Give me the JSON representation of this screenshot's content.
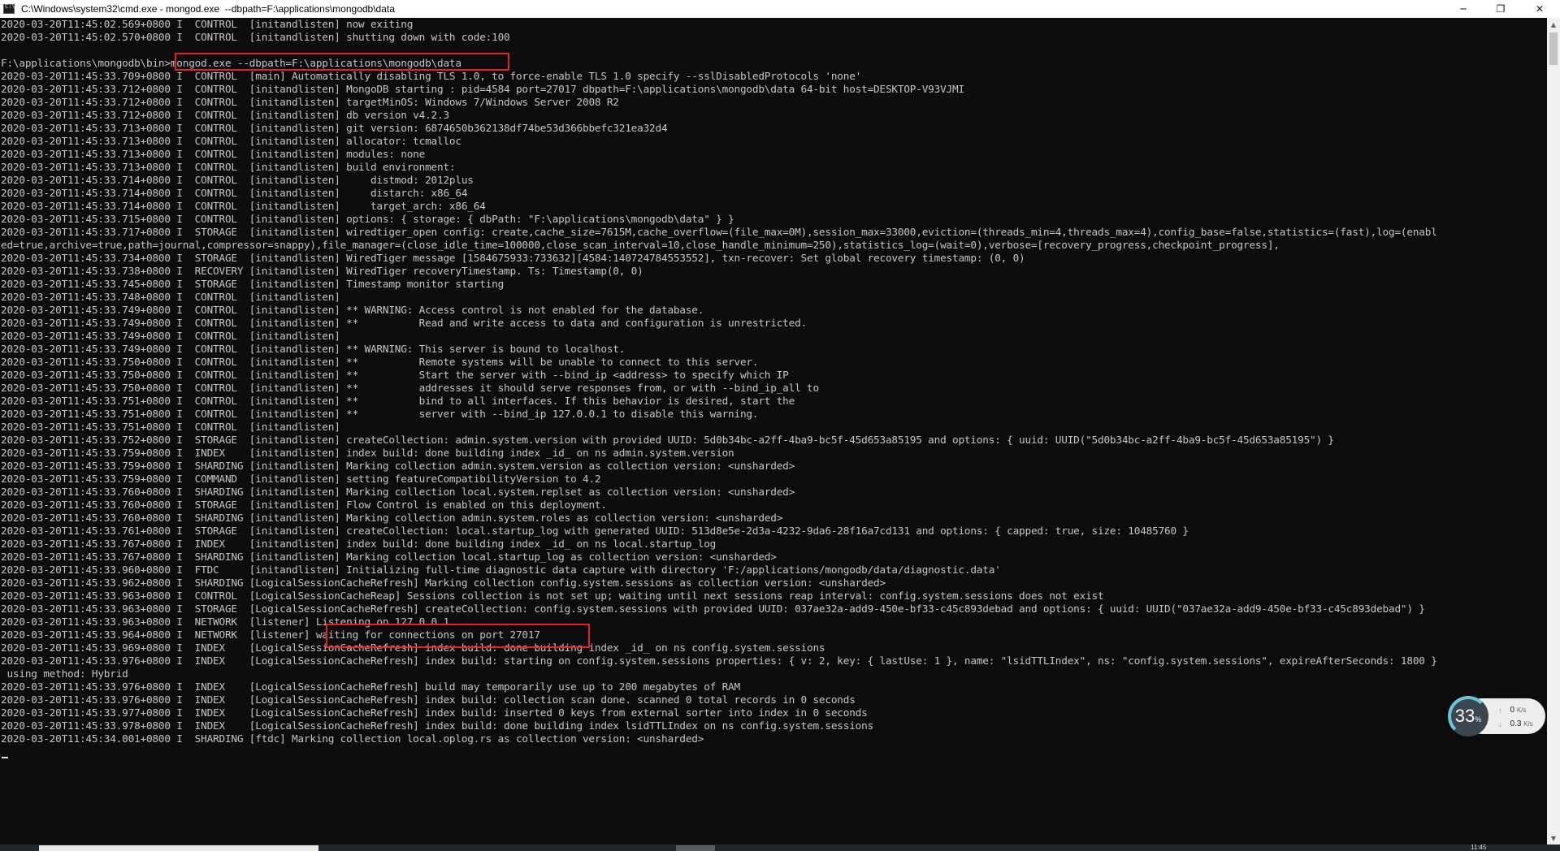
{
  "window": {
    "title": "C:\\Windows\\system32\\cmd.exe - mongod.exe  --dbpath=F:\\applications\\mongodb\\data",
    "minimize": "─",
    "maximize": "❐",
    "close": "✕"
  },
  "console_lines": [
    "2020-03-20T11:45:02.569+0800 I  CONTROL  [initandlisten] now exiting",
    "2020-03-20T11:45:02.570+0800 I  CONTROL  [initandlisten] shutting down with code:100",
    "",
    "F:\\applications\\mongodb\\bin>mongod.exe --dbpath=F:\\applications\\mongodb\\data",
    "2020-03-20T11:45:33.709+0800 I  CONTROL  [main] Automatically disabling TLS 1.0, to force-enable TLS 1.0 specify --sslDisabledProtocols 'none'",
    "2020-03-20T11:45:33.712+0800 I  CONTROL  [initandlisten] MongoDB starting : pid=4584 port=27017 dbpath=F:\\applications\\mongodb\\data 64-bit host=DESKTOP-V93VJMI",
    "2020-03-20T11:45:33.712+0800 I  CONTROL  [initandlisten] targetMinOS: Windows 7/Windows Server 2008 R2",
    "2020-03-20T11:45:33.712+0800 I  CONTROL  [initandlisten] db version v4.2.3",
    "2020-03-20T11:45:33.713+0800 I  CONTROL  [initandlisten] git version: 6874650b362138df74be53d366bbefc321ea32d4",
    "2020-03-20T11:45:33.713+0800 I  CONTROL  [initandlisten] allocator: tcmalloc",
    "2020-03-20T11:45:33.713+0800 I  CONTROL  [initandlisten] modules: none",
    "2020-03-20T11:45:33.713+0800 I  CONTROL  [initandlisten] build environment:",
    "2020-03-20T11:45:33.714+0800 I  CONTROL  [initandlisten]     distmod: 2012plus",
    "2020-03-20T11:45:33.714+0800 I  CONTROL  [initandlisten]     distarch: x86_64",
    "2020-03-20T11:45:33.714+0800 I  CONTROL  [initandlisten]     target_arch: x86_64",
    "2020-03-20T11:45:33.715+0800 I  CONTROL  [initandlisten] options: { storage: { dbPath: \"F:\\applications\\mongodb\\data\" } }",
    "2020-03-20T11:45:33.717+0800 I  STORAGE  [initandlisten] wiredtiger_open config: create,cache_size=7615M,cache_overflow=(file_max=0M),session_max=33000,eviction=(threads_min=4,threads_max=4),config_base=false,statistics=(fast),log=(enabl",
    "ed=true,archive=true,path=journal,compressor=snappy),file_manager=(close_idle_time=100000,close_scan_interval=10,close_handle_minimum=250),statistics_log=(wait=0),verbose=[recovery_progress,checkpoint_progress],",
    "2020-03-20T11:45:33.734+0800 I  STORAGE  [initandlisten] WiredTiger message [1584675933:733632][4584:140724784553552], txn-recover: Set global recovery timestamp: (0, 0)",
    "2020-03-20T11:45:33.738+0800 I  RECOVERY [initandlisten] WiredTiger recoveryTimestamp. Ts: Timestamp(0, 0)",
    "2020-03-20T11:45:33.745+0800 I  STORAGE  [initandlisten] Timestamp monitor starting",
    "2020-03-20T11:45:33.748+0800 I  CONTROL  [initandlisten]",
    "2020-03-20T11:45:33.749+0800 I  CONTROL  [initandlisten] ** WARNING: Access control is not enabled for the database.",
    "2020-03-20T11:45:33.749+0800 I  CONTROL  [initandlisten] **          Read and write access to data and configuration is unrestricted.",
    "2020-03-20T11:45:33.749+0800 I  CONTROL  [initandlisten]",
    "2020-03-20T11:45:33.749+0800 I  CONTROL  [initandlisten] ** WARNING: This server is bound to localhost.",
    "2020-03-20T11:45:33.750+0800 I  CONTROL  [initandlisten] **          Remote systems will be unable to connect to this server.",
    "2020-03-20T11:45:33.750+0800 I  CONTROL  [initandlisten] **          Start the server with --bind_ip <address> to specify which IP",
    "2020-03-20T11:45:33.750+0800 I  CONTROL  [initandlisten] **          addresses it should serve responses from, or with --bind_ip_all to",
    "2020-03-20T11:45:33.751+0800 I  CONTROL  [initandlisten] **          bind to all interfaces. If this behavior is desired, start the",
    "2020-03-20T11:45:33.751+0800 I  CONTROL  [initandlisten] **          server with --bind_ip 127.0.0.1 to disable this warning.",
    "2020-03-20T11:45:33.751+0800 I  CONTROL  [initandlisten]",
    "2020-03-20T11:45:33.752+0800 I  STORAGE  [initandlisten] createCollection: admin.system.version with provided UUID: 5d0b34bc-a2ff-4ba9-bc5f-45d653a85195 and options: { uuid: UUID(\"5d0b34bc-a2ff-4ba9-bc5f-45d653a85195\") }",
    "2020-03-20T11:45:33.759+0800 I  INDEX    [initandlisten] index build: done building index _id_ on ns admin.system.version",
    "2020-03-20T11:45:33.759+0800 I  SHARDING [initandlisten] Marking collection admin.system.version as collection version: <unsharded>",
    "2020-03-20T11:45:33.759+0800 I  COMMAND  [initandlisten] setting featureCompatibilityVersion to 4.2",
    "2020-03-20T11:45:33.760+0800 I  SHARDING [initandlisten] Marking collection local.system.replset as collection version: <unsharded>",
    "2020-03-20T11:45:33.760+0800 I  STORAGE  [initandlisten] Flow Control is enabled on this deployment.",
    "2020-03-20T11:45:33.760+0800 I  SHARDING [initandlisten] Marking collection admin.system.roles as collection version: <unsharded>",
    "2020-03-20T11:45:33.761+0800 I  STORAGE  [initandlisten] createCollection: local.startup_log with generated UUID: 513d8e5e-2d3a-4232-9da6-28f16a7cd131 and options: { capped: true, size: 10485760 }",
    "2020-03-20T11:45:33.767+0800 I  INDEX    [initandlisten] index build: done building index _id_ on ns local.startup_log",
    "2020-03-20T11:45:33.767+0800 I  SHARDING [initandlisten] Marking collection local.startup_log as collection version: <unsharded>",
    "2020-03-20T11:45:33.960+0800 I  FTDC     [initandlisten] Initializing full-time diagnostic data capture with directory 'F:/applications/mongodb/data/diagnostic.data'",
    "2020-03-20T11:45:33.962+0800 I  SHARDING [LogicalSessionCacheRefresh] Marking collection config.system.sessions as collection version: <unsharded>",
    "2020-03-20T11:45:33.963+0800 I  CONTROL  [LogicalSessionCacheReap] Sessions collection is not set up; waiting until next sessions reap interval: config.system.sessions does not exist",
    "2020-03-20T11:45:33.963+0800 I  STORAGE  [LogicalSessionCacheRefresh] createCollection: config.system.sessions with provided UUID: 037ae32a-add9-450e-bf33-c45c893debad and options: { uuid: UUID(\"037ae32a-add9-450e-bf33-c45c893debad\") }",
    "2020-03-20T11:45:33.963+0800 I  NETWORK  [listener] Listening on 127.0.0.1",
    "2020-03-20T11:45:33.964+0800 I  NETWORK  [listener] waiting for connections on port 27017",
    "2020-03-20T11:45:33.969+0800 I  INDEX    [LogicalSessionCacheRefresh] index build: done building index _id_ on ns config.system.sessions",
    "2020-03-20T11:45:33.976+0800 I  INDEX    [LogicalSessionCacheRefresh] index build: starting on config.system.sessions properties: { v: 2, key: { lastUse: 1 }, name: \"lsidTTLIndex\", ns: \"config.system.sessions\", expireAfterSeconds: 1800 }",
    " using method: Hybrid",
    "2020-03-20T11:45:33.976+0800 I  INDEX    [LogicalSessionCacheRefresh] build may temporarily use up to 200 megabytes of RAM",
    "2020-03-20T11:45:33.976+0800 I  INDEX    [LogicalSessionCacheRefresh] index build: collection scan done. scanned 0 total records in 0 seconds",
    "2020-03-20T11:45:33.977+0800 I  INDEX    [LogicalSessionCacheRefresh] index build: inserted 0 keys from external sorter into index in 0 seconds",
    "2020-03-20T11:45:33.978+0800 I  INDEX    [LogicalSessionCacheRefresh] index build: done building index lsidTTLIndex on ns config.system.sessions",
    "2020-03-20T11:45:34.001+0800 I  SHARDING [ftdc] Marking collection local.oplog.rs as collection version: <unsharded>"
  ],
  "net_widget": {
    "percent": "33",
    "percent_unit": "%",
    "upload": "0",
    "upload_unit": "K/s",
    "download": "0.3",
    "download_unit": "K/s",
    "upload_color": "#2a9fd6",
    "download_color": "#3cb371"
  },
  "taskbar": {
    "clock": "11:45"
  },
  "colors": {
    "console_bg": "#0c0c0c",
    "console_text": "#c6c6c6",
    "highlight": "#e8221c"
  }
}
